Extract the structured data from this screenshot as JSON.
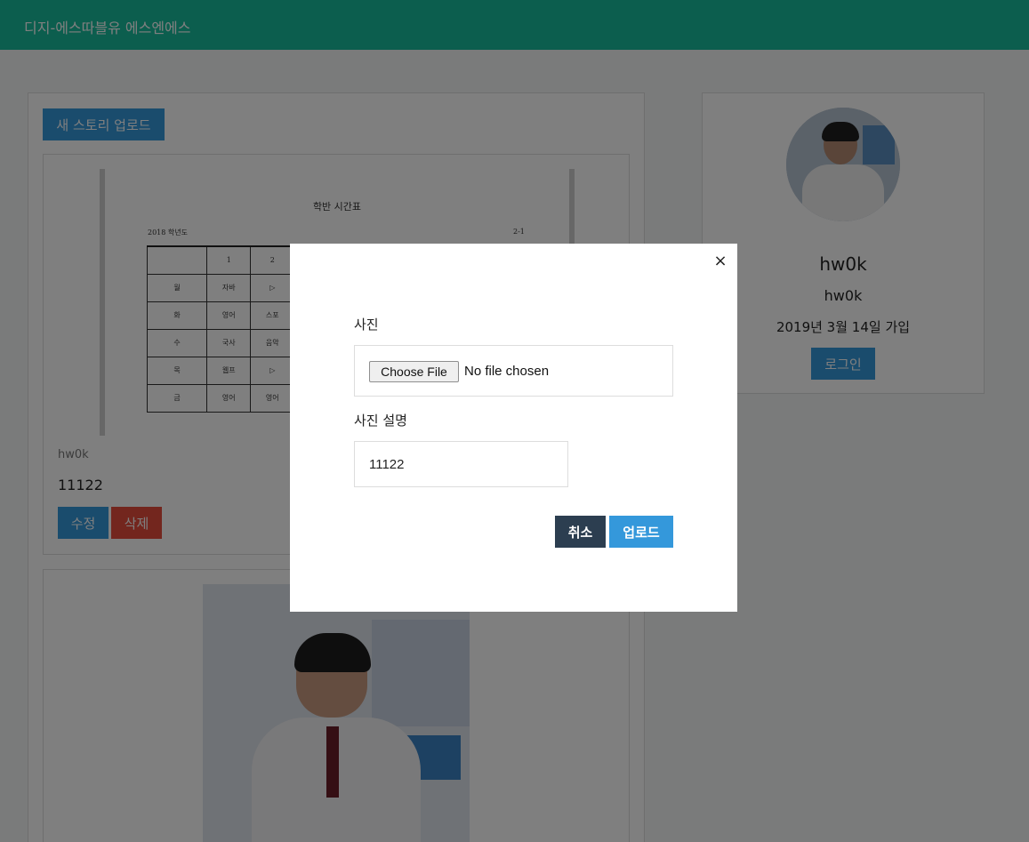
{
  "navbar": {
    "brand": "디지-에스따블유 에스엔에스"
  },
  "feed": {
    "new_story_label": "새 스토리 업로드",
    "posts": [
      {
        "image": {
          "title": "학반 시간표",
          "year": "2018 학년도",
          "class": "2-1",
          "header": [
            "",
            "1",
            "2"
          ],
          "rows": [
            [
              "월",
              "자바",
              "▷"
            ],
            [
              "화",
              "영어",
              "스포"
            ],
            [
              "수",
              "국사",
              "음악"
            ],
            [
              "목",
              "웹프",
              "▷"
            ],
            [
              "금",
              "영어",
              "영어"
            ]
          ]
        },
        "username": "hw0k",
        "caption": "11122",
        "edit_label": "수정",
        "delete_label": "삭제"
      }
    ]
  },
  "profile": {
    "display_name": "hw0k",
    "username": "hw0k",
    "joined": "2019년 3월 14일 가입",
    "login_label": "로그인"
  },
  "modal": {
    "close_glyph": "×",
    "photo_label": "사진",
    "file_button_label": "Choose File",
    "file_status": "No file chosen",
    "description_label": "사진 설명",
    "description_value": "11122",
    "cancel_label": "취소",
    "upload_label": "업로드"
  },
  "colors": {
    "navbar": "#18bc9c",
    "primary": "#3498db",
    "danger": "#e74c3c",
    "dark": "#2c3e50"
  }
}
